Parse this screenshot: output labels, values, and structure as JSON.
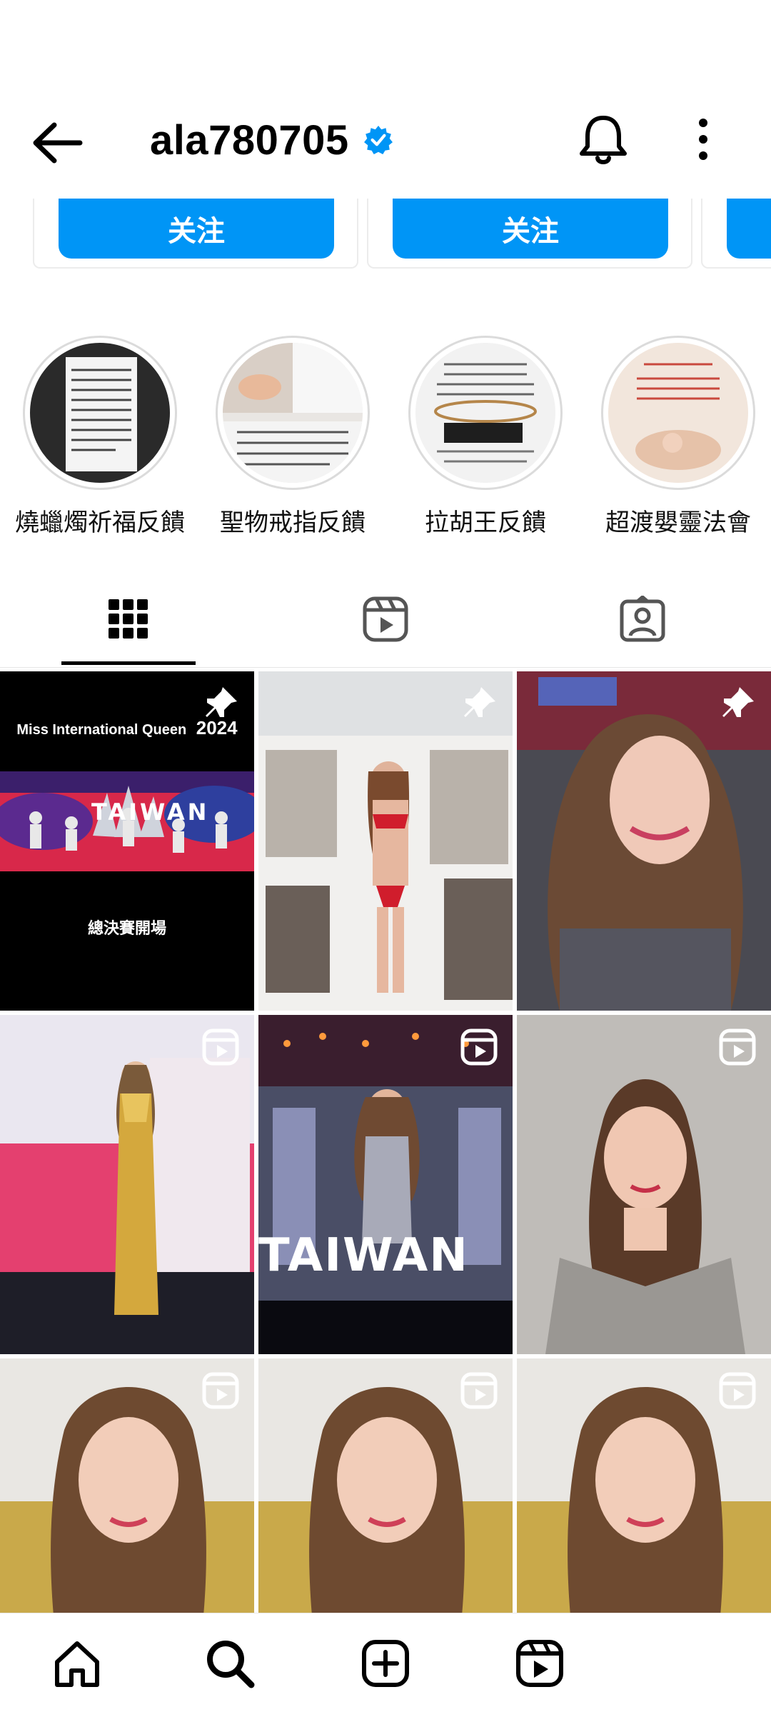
{
  "header": {
    "username": "ala780705",
    "back_icon": "arrow-left-icon",
    "verified_icon": "verified-badge-icon",
    "notifications_icon": "bell-icon",
    "more_icon": "vertical-ellipsis-icon"
  },
  "suggested": {
    "follow_label": "关注",
    "accent": "#0095f6"
  },
  "highlights": [
    {
      "label": "燒蠟燭祈福反饋"
    },
    {
      "label": "聖物戒指反饋"
    },
    {
      "label": "拉胡王反饋"
    },
    {
      "label": "超渡嬰靈法會"
    }
  ],
  "tabs": [
    {
      "name": "posts",
      "icon": "grid-icon",
      "active": true
    },
    {
      "name": "reels",
      "icon": "reels-icon",
      "active": false
    },
    {
      "name": "tagged",
      "icon": "tagged-person-icon",
      "active": false
    }
  ],
  "grid": {
    "post1": {
      "title": "Miss International Queen",
      "year": "2024",
      "stage_text": "TAIWAN",
      "caption": "總決賽開場",
      "badge": "pin-icon"
    },
    "post2": {
      "badge": "pin-icon"
    },
    "post3": {
      "badge": "pin-icon"
    },
    "post4": {
      "badge": "reel-icon"
    },
    "post5": {
      "stage_text": "TAIWAN",
      "badge": "reel-icon"
    },
    "post6": {
      "badge": "reel-icon"
    },
    "post7": {
      "badge": "reel-icon"
    },
    "post8": {
      "badge": "reel-icon"
    },
    "post9": {
      "badge": "reel-icon"
    }
  },
  "bottom_nav": [
    {
      "icon": "home-icon"
    },
    {
      "icon": "search-icon"
    },
    {
      "icon": "add-post-icon"
    },
    {
      "icon": "reels-icon"
    }
  ]
}
